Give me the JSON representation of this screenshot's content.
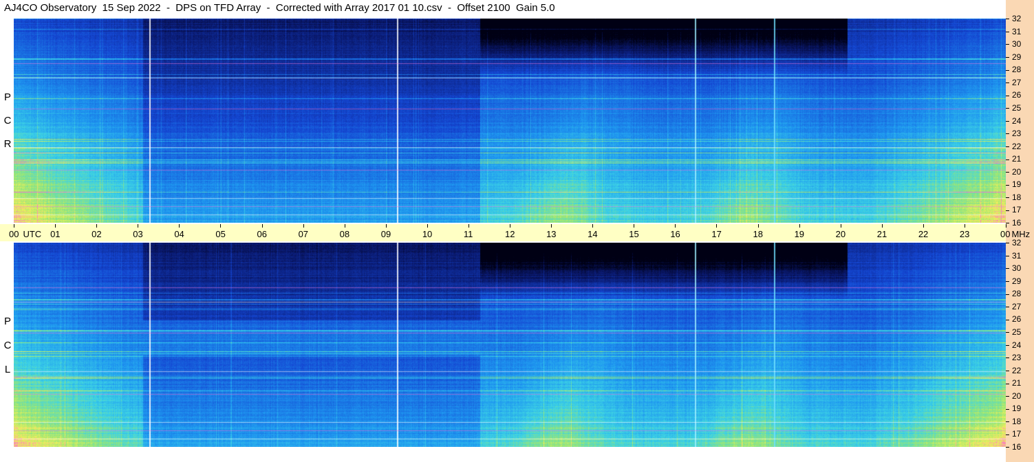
{
  "title": "AJ4CO Observatory  15 Sep 2022  -  DPS on TFD Array  -  Corrected with Array 2017 01 10.csv  -  Offset 2100  Gain 5.0",
  "panels": {
    "top": {
      "label_letters": [
        "P",
        "C",
        "R"
      ]
    },
    "bottom": {
      "label_letters": [
        "P",
        "C",
        "L"
      ]
    }
  },
  "frequency_axis": {
    "unit": "MHz",
    "ticks": [
      "32",
      "31",
      "30",
      "29",
      "28",
      "27",
      "26",
      "25",
      "24",
      "23",
      "22",
      "21",
      "20",
      "19",
      "18",
      "17",
      "16"
    ]
  },
  "time_axis": {
    "unit": "UTC",
    "ticks": [
      "00",
      "01",
      "02",
      "03",
      "04",
      "05",
      "06",
      "07",
      "08",
      "09",
      "10",
      "11",
      "12",
      "13",
      "14",
      "15",
      "16",
      "17",
      "18",
      "19",
      "20",
      "21",
      "22",
      "23",
      "00"
    ]
  },
  "colors": {
    "utc_bar": "#ffffc4",
    "freq_col": "#fad8b4"
  }
}
